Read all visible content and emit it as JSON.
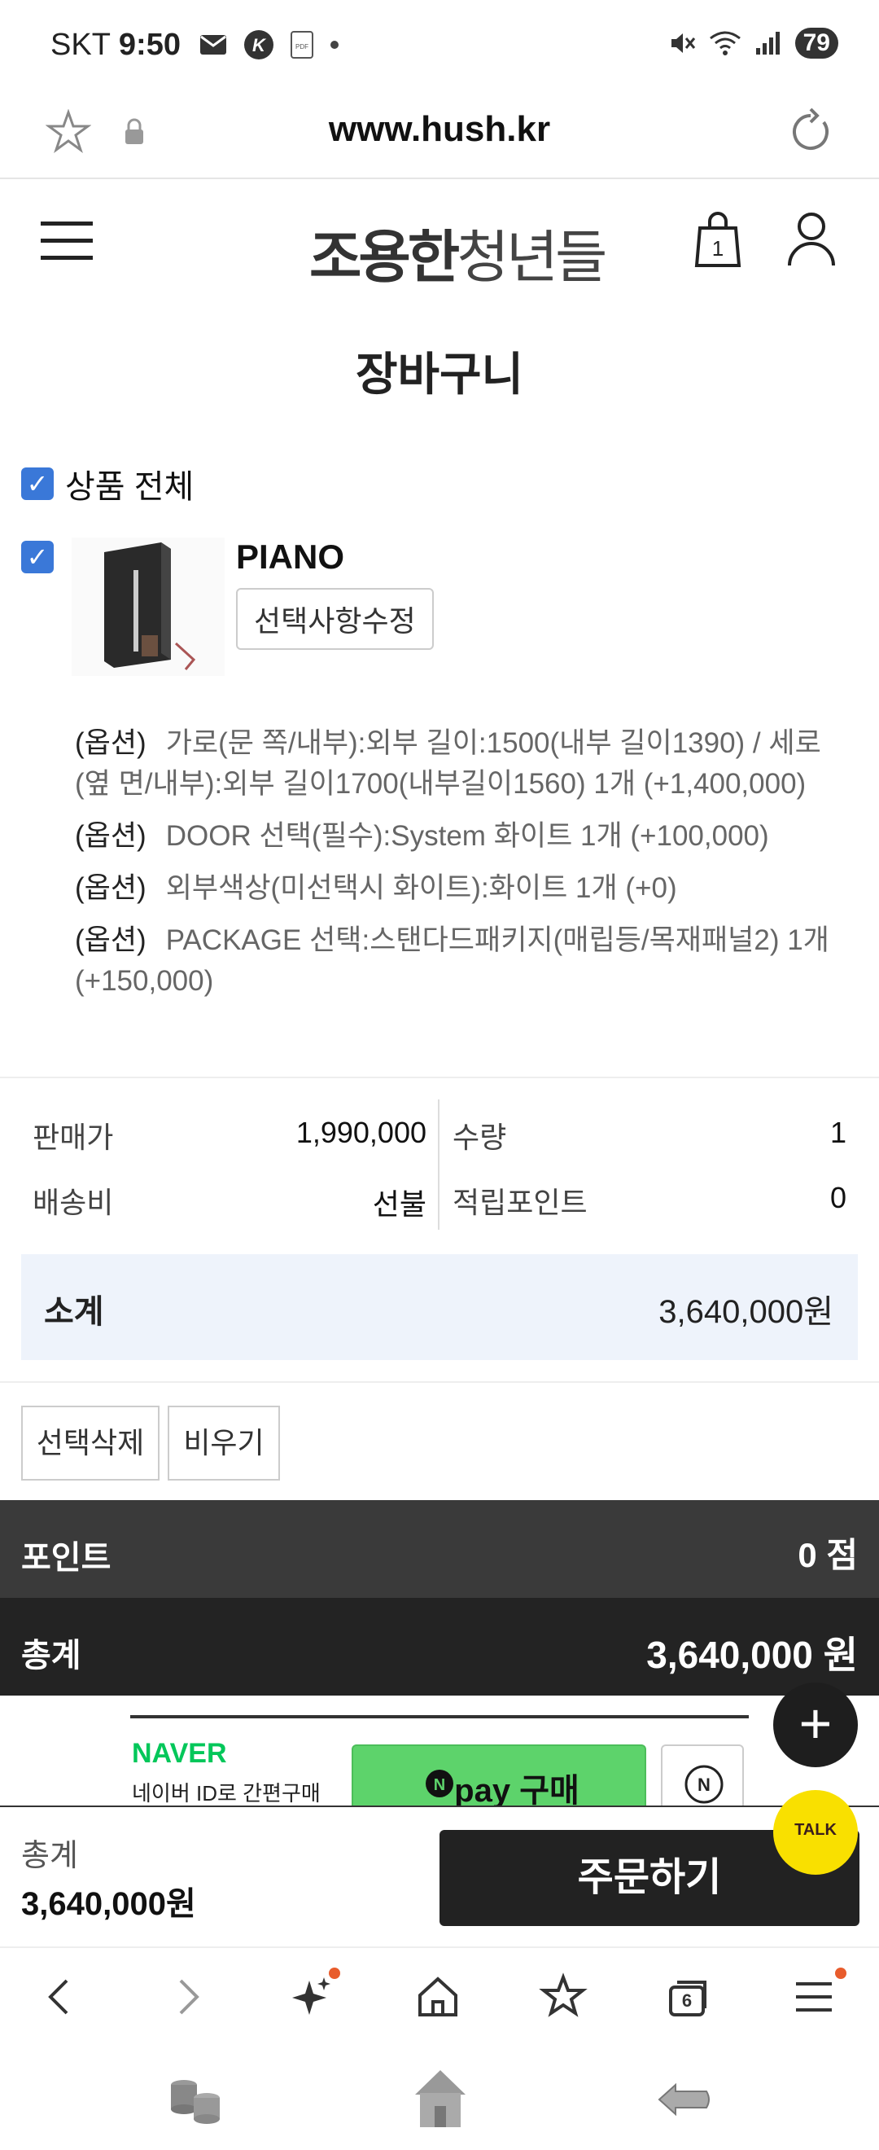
{
  "status_bar": {
    "carrier": "SKT",
    "time": "9:50",
    "battery": "79"
  },
  "url_bar": {
    "url": "www.hush.kr"
  },
  "site": {
    "logo_bold": "조용한",
    "logo_light": "청년들",
    "cart_count": "1"
  },
  "page": {
    "title": "장바구니"
  },
  "cart": {
    "select_all_label": "상품 전체",
    "item": {
      "name": "PIANO",
      "edit_label": "선택사항수정",
      "options": [
        {
          "tag": "(옵션)",
          "text": "가로(문 쪽/내부):외부 길이:1500(내부 길이1390) / 세로(옆 면/내부):외부 길이1700(내부길이1560) 1개 (+1,400,000)"
        },
        {
          "tag": "(옵션)",
          "text": "DOOR 선택(필수):System 화이트 1개 (+100,000)"
        },
        {
          "tag": "(옵션)",
          "text": "외부색상(미선택시 화이트):화이트 1개 (+0)"
        },
        {
          "tag": "(옵션)",
          "text": "PACKAGE 선택:스탠다드패키지(매립등/목재패널2) 1개 (+150,000)"
        }
      ]
    },
    "price": {
      "sale_label": "판매가",
      "sale_value": "1,990,000",
      "qty_label": "수량",
      "qty_value": "1",
      "shipping_label": "배송비",
      "shipping_value": "선불",
      "points_label": "적립포인트",
      "points_value": "0"
    },
    "subtotal": {
      "label": "소계",
      "value": "3,640,000원"
    },
    "buttons": {
      "delete_selected": "선택삭제",
      "clear": "비우기"
    }
  },
  "summary": {
    "point_label": "포인트",
    "point_value": "0 점",
    "total_label": "총계",
    "total_value": "3,640,000 원"
  },
  "naver": {
    "brand": "NAVER",
    "subtitle": "네이버 ID로 간편구매",
    "pay_label": "pay 구매"
  },
  "order_bar": {
    "total_label": "총계",
    "total_value": "3,640,000원",
    "order_button": "주문하기"
  },
  "talk": {
    "label": "TALK"
  },
  "browser_nav": {
    "tabs_count": "6"
  },
  "colors": {
    "checkbox": "#3a78d8",
    "naver_green": "#03c75a",
    "kakao_yellow": "#f9e000"
  }
}
